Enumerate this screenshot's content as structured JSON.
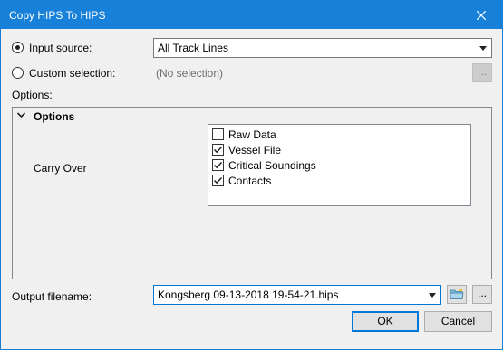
{
  "window": {
    "title": "Copy HIPS To HIPS"
  },
  "input_source": {
    "label": "Input source:",
    "selected": true,
    "value": "All Track Lines"
  },
  "custom_selection": {
    "label": "Custom selection:",
    "selected": false,
    "value": "(No selection)",
    "browse_label": "..."
  },
  "options": {
    "section_label": "Options:",
    "group_label": "Options",
    "carry_over_label": "Carry Over",
    "items": [
      {
        "label": "Raw Data",
        "checked": false
      },
      {
        "label": "Vessel File",
        "checked": true
      },
      {
        "label": "Critical Soundings",
        "checked": true
      },
      {
        "label": "Contacts",
        "checked": true
      }
    ]
  },
  "output": {
    "label": "Output filename:",
    "value": "Kongsberg 09-13-2018 19-54-21.hips",
    "browse_label": "..."
  },
  "buttons": {
    "ok": "OK",
    "cancel": "Cancel"
  },
  "colors": {
    "titlebar": "#1780d8",
    "accent": "#0078d7",
    "window_bg": "#f0f0f0"
  },
  "icons": {
    "close": "close-icon",
    "dropdown": "chevron-down-icon",
    "expander": "chevron-down-icon",
    "folder": "folder-icon",
    "check": "check-icon"
  }
}
